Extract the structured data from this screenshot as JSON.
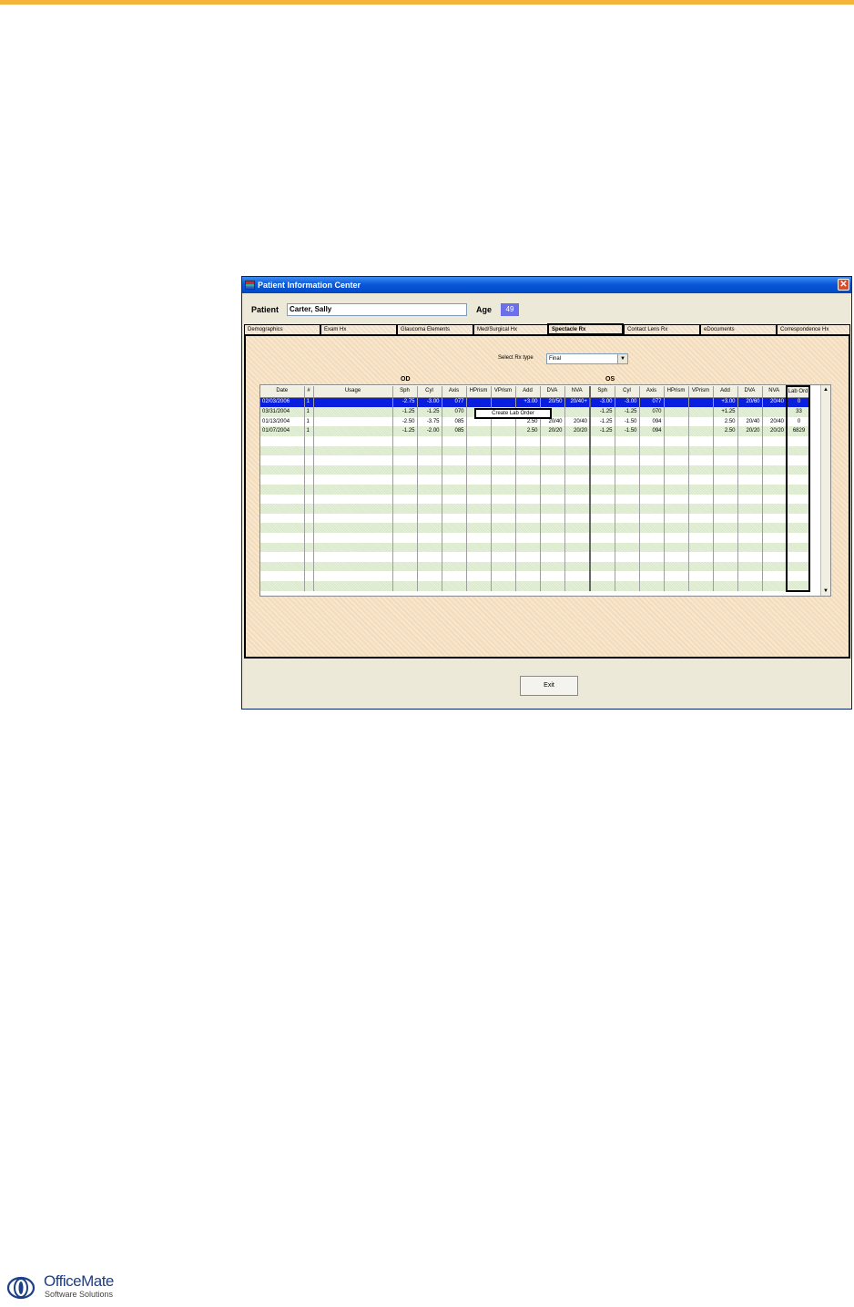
{
  "window": {
    "title": "Patient Information Center",
    "close_glyph": "✕"
  },
  "patient": {
    "label": "Patient",
    "name": "Carter, Sally",
    "age_label": "Age",
    "age": "49"
  },
  "tabs": [
    {
      "label": "Demographics",
      "active": false
    },
    {
      "label": "Exam Hx",
      "active": false
    },
    {
      "label": "Glaucoma Elements",
      "active": false
    },
    {
      "label": "Med/Surgical Hx",
      "active": false
    },
    {
      "label": "Spectacle Rx",
      "active": true
    },
    {
      "label": "Contact Lens Rx",
      "active": false
    },
    {
      "label": "eDocuments",
      "active": false
    },
    {
      "label": "Correspondence Hx",
      "active": false
    }
  ],
  "rx_type": {
    "label": "Select Rx type",
    "value": "Final"
  },
  "groups": {
    "od": "OD",
    "os": "OS"
  },
  "grid": {
    "columns": [
      "Date",
      "#",
      "Usage",
      "Sph",
      "Cyl",
      "Axis",
      "HPrism",
      "VPrism",
      "Add",
      "DVA",
      "NVA",
      "Sph",
      "Cyl",
      "Axis",
      "HPrism",
      "VPrism",
      "Add",
      "DVA",
      "NVA",
      "Lab Ord"
    ],
    "rows": [
      [
        "02/03/2006",
        "1",
        "",
        "-2.75",
        "-3.00",
        "077",
        "",
        "",
        "+3.00",
        "20/50",
        "20/40+",
        "-3.00",
        "-3.00",
        "077",
        "",
        "",
        "+3.00",
        "20/60",
        "20/40",
        "0"
      ],
      [
        "03/31/2004",
        "1",
        "",
        "-1.25",
        "-1.25",
        "070",
        "",
        "",
        "",
        "",
        "",
        "-1.25",
        "-1.25",
        "070",
        "",
        "",
        "+1.25",
        "",
        "",
        "33"
      ],
      [
        "01/13/2004",
        "1",
        "",
        "-2.50",
        "-3.75",
        "085",
        "",
        "",
        "2.50",
        "20/40",
        "20/40",
        "-1.25",
        "-1.50",
        "094",
        "",
        "",
        "2.50",
        "20/40",
        "20/40",
        "0"
      ],
      [
        "01/07/2004",
        "1",
        "",
        "-1.25",
        "-2.00",
        "085",
        "",
        "",
        "2.50",
        "20/20",
        "20/20",
        "-1.25",
        "-1.50",
        "094",
        "",
        "",
        "2.50",
        "20/20",
        "20/20",
        "6829"
      ]
    ],
    "empty_rows": 16,
    "selected_row": 0
  },
  "context_menu": {
    "item": "Create Lab Order"
  },
  "exit_button": "Exit",
  "logo": {
    "name": "OfficeMate",
    "tagline": "Software Solutions"
  },
  "colors": {
    "accent_rule": "#f5b43a",
    "selection": "#0a1ee0",
    "titlebar": "#0a58d8"
  }
}
